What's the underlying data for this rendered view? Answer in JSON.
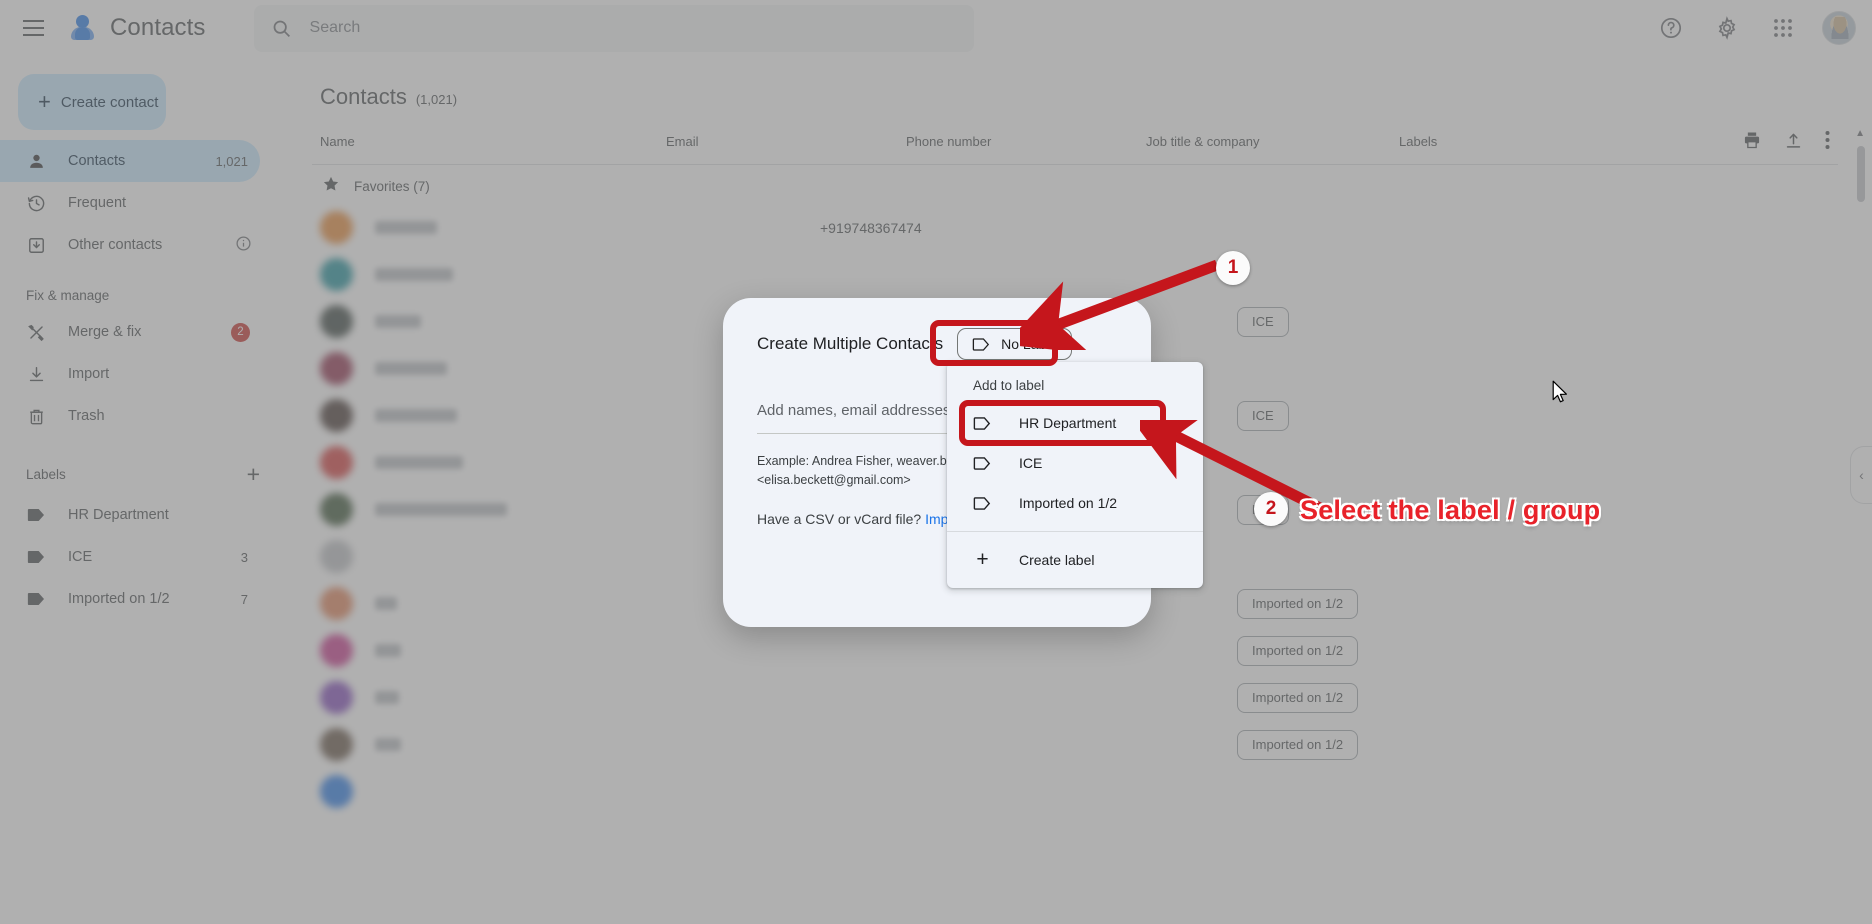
{
  "app": {
    "title": "Contacts"
  },
  "search": {
    "placeholder": "Search",
    "icon": "search-icon"
  },
  "topbar": {
    "menu_icon": "hamburger-menu-icon",
    "help_icon": "help-circle-icon",
    "settings_icon": "gear-icon",
    "apps_icon": "apps-grid-icon",
    "avatar": "account-avatar"
  },
  "sidebar": {
    "create_contact_label": "Create contact",
    "nav": [
      {
        "label": "Contacts",
        "count": "1,021",
        "icon": "person-icon",
        "active": true
      },
      {
        "label": "Frequent",
        "count": "",
        "icon": "history-clock-icon",
        "active": false
      },
      {
        "label": "Other contacts",
        "count": "",
        "icon": "archive-down-icon",
        "active": false,
        "info_icon": "info-circle-icon"
      }
    ],
    "fix_manage_heading": "Fix & manage",
    "manage": [
      {
        "label": "Merge & fix",
        "badge": "2",
        "icon": "merge-tools-icon"
      },
      {
        "label": "Import",
        "badge": "",
        "icon": "download-icon"
      },
      {
        "label": "Trash",
        "badge": "",
        "icon": "trash-icon"
      }
    ],
    "labels_heading": "Labels",
    "labels_add_icon": "plus-icon",
    "labels": [
      {
        "label": "HR Department",
        "count": "",
        "icon": "label-tag-icon"
      },
      {
        "label": "ICE",
        "count": "3",
        "icon": "label-tag-icon"
      },
      {
        "label": "Imported on 1/2",
        "count": "7",
        "icon": "label-tag-icon"
      }
    ]
  },
  "main": {
    "page_title": "Contacts",
    "page_count": "(1,021)",
    "columns": {
      "name": "Name",
      "email": "Email",
      "phone": "Phone number",
      "job": "Job title & company",
      "labels": "Labels"
    },
    "head_actions": [
      {
        "icon": "print-icon",
        "name": "print-button"
      },
      {
        "icon": "export-upload-icon",
        "name": "export-button"
      },
      {
        "icon": "more-vertical-icon",
        "name": "more-options-button"
      }
    ],
    "favorites_heading": "Favorites (7)",
    "favorites_star_icon": "star-icon",
    "rows": [
      {
        "avatar_color": "#e8832a",
        "name_w": 62,
        "phone": "+919748367474",
        "label": ""
      },
      {
        "avatar_color": "#0f8a96",
        "name_w": 78,
        "phone": "",
        "label": ""
      },
      {
        "avatar_color": "#2f3b37",
        "name_w": 46,
        "phone": "",
        "label": "ICE"
      },
      {
        "avatar_color": "#8b2342",
        "name_w": 72,
        "phone": "",
        "label": ""
      },
      {
        "avatar_color": "#3a2a26",
        "name_w": 82,
        "phone": "",
        "label": "ICE"
      },
      {
        "avatar_color": "#d32f2f",
        "name_w": 88,
        "phone": "",
        "label": ""
      },
      {
        "avatar_color": "#2e4a2a",
        "name_w": 132,
        "phone": "",
        "label": "ICE"
      },
      {
        "avatar_color": "#b9bcc0",
        "name_w": 0,
        "phone": "",
        "label": ""
      },
      {
        "avatar_color": "#e07b4f",
        "name_w": 22,
        "phone": "",
        "label": "Imported on 1/2"
      },
      {
        "avatar_color": "#c62a86",
        "name_w": 26,
        "phone": "",
        "label": "Imported on 1/2"
      },
      {
        "avatar_color": "#7b3fb8",
        "name_w": 24,
        "phone": "",
        "label": "Imported on 1/2"
      },
      {
        "avatar_color": "#5c4a3a",
        "name_w": 26,
        "phone": "",
        "label": "Imported on 1/2"
      },
      {
        "avatar_color": "#1a73e8",
        "name_w": 0,
        "phone": "",
        "label": ""
      }
    ],
    "side_expander_icon": "chevron-left-icon",
    "scroll_up_icon": "caret-up-icon"
  },
  "dialog": {
    "title": "Create Multiple Contacts",
    "no_label_chip": "No Label",
    "no_label_icon": "label-tag-outline-icon",
    "input_placeholder": "Add names, email addresses, or",
    "example_line1": "Example: Andrea Fisher, weaver.blake",
    "example_line2": "<elisa.beckett@gmail.com>",
    "csv_text": "Have a CSV or vCard file?",
    "csv_link": "Impor"
  },
  "menu": {
    "heading": "Add to label",
    "items": [
      {
        "label": "HR Department",
        "icon": "label-tag-outline-icon",
        "highlighted": true
      },
      {
        "label": "ICE",
        "icon": "label-tag-outline-icon",
        "highlighted": false
      },
      {
        "label": "Imported on 1/2",
        "icon": "label-tag-outline-icon",
        "highlighted": false
      }
    ],
    "create_label": "Create label",
    "create_icon": "plus-icon"
  },
  "annotations": {
    "colors": {
      "accent": "#c5161c",
      "text": "#e8222a"
    },
    "step1": {
      "number": "1"
    },
    "step2": {
      "number": "2",
      "text": "Select the label / group"
    }
  }
}
